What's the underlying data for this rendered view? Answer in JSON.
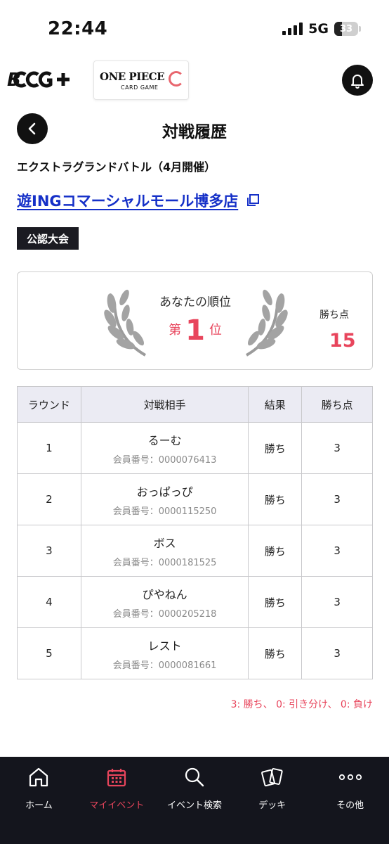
{
  "status_bar": {
    "time": "22:44",
    "network": "5G",
    "battery": "33"
  },
  "header": {
    "brand": "B ᴄᴄᴳ+",
    "game_logo_title": "ONE PIECE",
    "game_logo_sub": "CARD GAME"
  },
  "page": {
    "title": "対戦履歴",
    "event_name": "エクストラグランドバトル（4月開催）",
    "store_name": "遊INGコマーシャルモール博多店",
    "tag": "公認大会"
  },
  "rank": {
    "label": "あなたの順位",
    "prefix": "第",
    "value": "1",
    "suffix": "位",
    "points_label": "勝ち点",
    "points_value": "15"
  },
  "table": {
    "headers": {
      "round": "ラウンド",
      "opponent": "対戦相手",
      "result": "結果",
      "points": "勝ち点"
    },
    "rows": [
      {
        "round": "1",
        "name": "るーむ",
        "member": "会員番号：0000076413",
        "result": "勝ち",
        "points": "3"
      },
      {
        "round": "2",
        "name": "おっぱっぴ",
        "member": "会員番号：0000115250",
        "result": "勝ち",
        "points": "3"
      },
      {
        "round": "3",
        "name": "ボス",
        "member": "会員番号：0000181525",
        "result": "勝ち",
        "points": "3"
      },
      {
        "round": "4",
        "name": "ぴやねん",
        "member": "会員番号：0000205218",
        "result": "勝ち",
        "points": "3"
      },
      {
        "round": "5",
        "name": "レスト",
        "member": "会員番号：0000081661",
        "result": "勝ち",
        "points": "3"
      }
    ]
  },
  "legend": "3: 勝ち、 0: 引き分け、 0: 負け",
  "nav": {
    "home": "ホーム",
    "my_event": "マイイベント",
    "event_search": "イベント検索",
    "deck": "デッキ",
    "other": "その他"
  },
  "colors": {
    "accent": "#e8455c",
    "link": "#1530c8",
    "dark": "#14151d",
    "table_header": "#ebebf3"
  }
}
